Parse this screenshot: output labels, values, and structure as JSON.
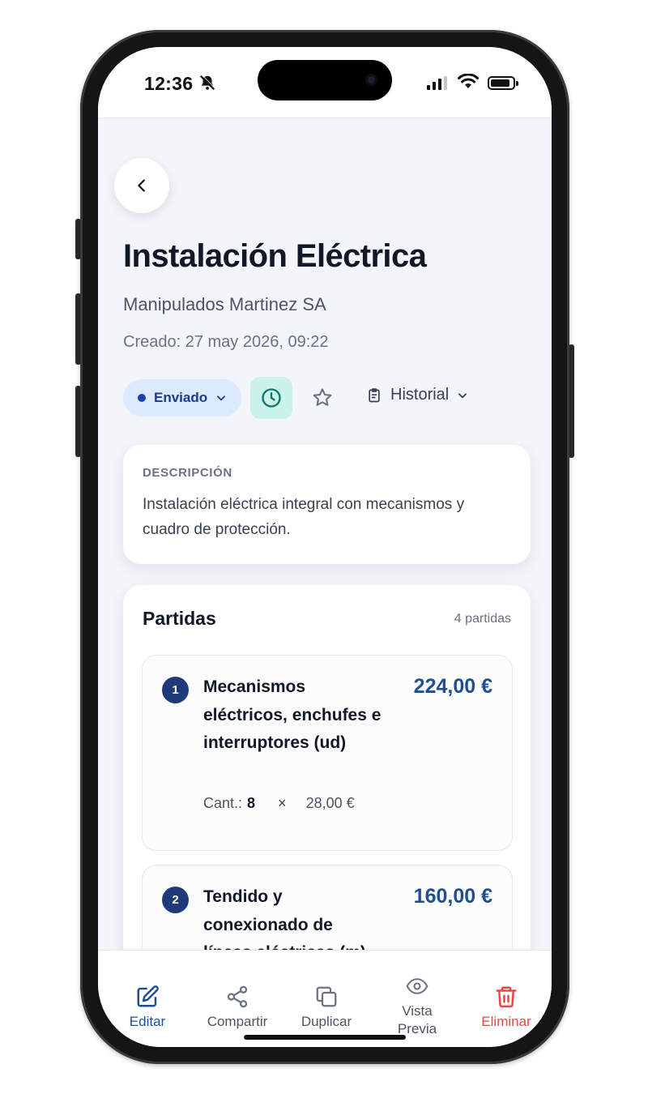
{
  "status_bar": {
    "time": "12:36"
  },
  "header": {
    "title": "Instalación Eléctrica",
    "client": "Manipulados Martinez SA",
    "created": "Creado: 27 may 2026, 09:22"
  },
  "actions": {
    "status_label": "Enviado",
    "history_label": "Historial",
    "icons": [
      "clock-icon",
      "star-icon",
      "clipboard-icon",
      "chevron-down-icon"
    ]
  },
  "description": {
    "label": "DESCRIPCIÓN",
    "text": "Instalación eléctrica integral con mecanismos y cuadro de protección."
  },
  "items": {
    "title": "Partidas",
    "count": "4 partidas",
    "list": [
      {
        "number": "1",
        "name": "Mecanismos eléctricos, enchufes e interruptores (ud)",
        "price": "224,00 €",
        "qty_label": "Cant.:",
        "qty": "8",
        "times": "×",
        "unit_price": "28,00 €"
      },
      {
        "number": "2",
        "name": "Tendido y conexionado de líneas eléctricas (m)",
        "price": "160,00 €"
      }
    ]
  },
  "bottom_bar": {
    "edit": "Editar",
    "share": "Compartir",
    "duplicate": "Duplicar",
    "preview": "Vista Previa",
    "delete": "Eliminar"
  },
  "colors": {
    "accent": "#1e4f95",
    "status_bg": "#dbeafe",
    "clock_bg": "#c9f2ea",
    "delete": "#ef4444"
  }
}
